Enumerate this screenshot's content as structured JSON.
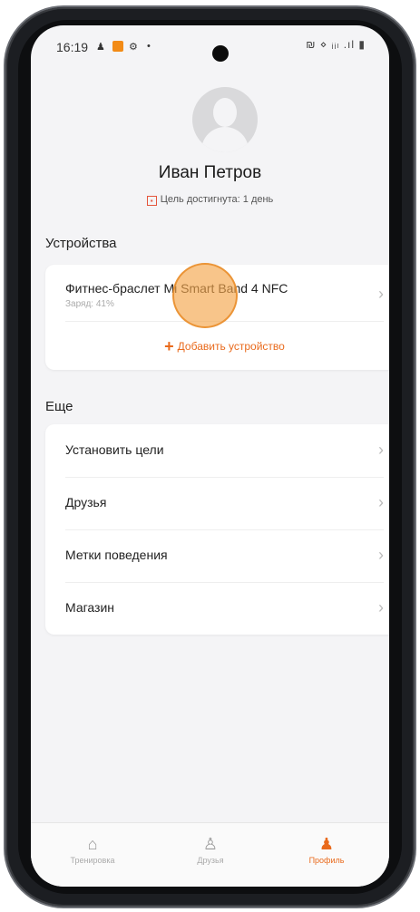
{
  "status_bar": {
    "time": "16:19",
    "icons": "₪ ⋄ ᵢᵢₗ .ıl ▮"
  },
  "profile": {
    "name": "Иван Петров",
    "goal_text": "Цель достигнута: 1 день"
  },
  "devices": {
    "title": "Устройства",
    "items": [
      {
        "name": "Фитнес-браслет Mi Smart Band 4 NFC",
        "charge": "Заряд: 41%"
      }
    ],
    "add_label": "Добавить устройство"
  },
  "more": {
    "title": "Еще",
    "items": [
      {
        "label": "Установить цели"
      },
      {
        "label": "Друзья"
      },
      {
        "label": "Метки поведения"
      },
      {
        "label": "Магазин"
      }
    ]
  },
  "tabs": [
    {
      "label": "Тренировка",
      "icon": "home-icon"
    },
    {
      "label": "Друзья",
      "icon": "friends-icon"
    },
    {
      "label": "Профиль",
      "icon": "profile-icon",
      "active": true
    }
  ],
  "colors": {
    "accent": "#e96a1c",
    "background": "#f4f4f6"
  }
}
